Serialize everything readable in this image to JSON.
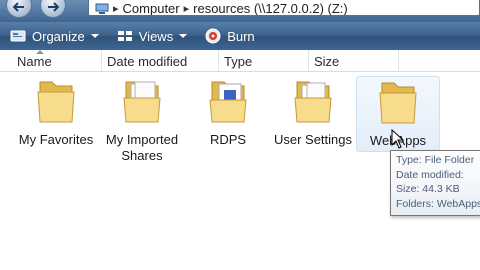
{
  "address_bar": {
    "location": "Computer",
    "path": "resources (\\\\127.0.0.2) (Z:)"
  },
  "toolbar": {
    "organize_label": "Organize",
    "views_label": "Views",
    "burn_label": "Burn"
  },
  "columns": {
    "name": "Name",
    "date_modified": "Date modified",
    "type": "Type",
    "size": "Size"
  },
  "items": [
    {
      "label": "My Favorites",
      "icon": "folder-icon"
    },
    {
      "label": "My Imported Shares",
      "icon": "folder-documents-icon"
    },
    {
      "label": "RDPS",
      "icon": "folder-documents-icon"
    },
    {
      "label": "User Settings",
      "icon": "folder-documents-icon"
    },
    {
      "label": "WebApps",
      "icon": "folder-icon"
    }
  ],
  "tooltip": {
    "type_line": "Type: File Folder",
    "date_line": "Date modified:",
    "size_line": "Size: 44.3 KB",
    "folders_line": "Folders: WebApps"
  },
  "colors": {
    "toolbar": "#3a5f88",
    "folder": "#f2d27a",
    "tooltip_text": "#4c607a"
  }
}
